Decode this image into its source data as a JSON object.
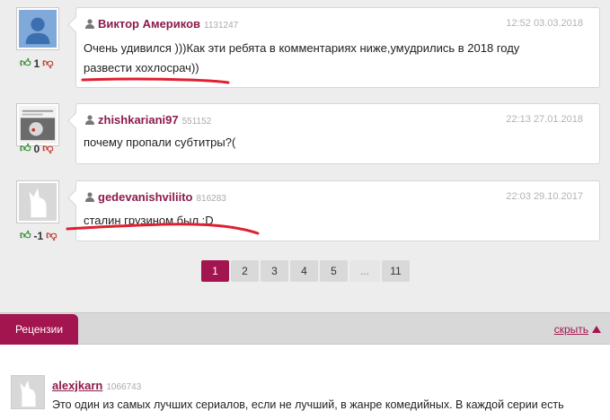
{
  "comments": [
    {
      "author": "Виктор Америков",
      "uid": "1131247",
      "date": "12:52 03.03.2018",
      "text_line1": "Очень удивился )))Как эти ребята в комментариях ниже,умудрились в 2018 году",
      "text_line2": "развести хохлосрач))",
      "votes": "1"
    },
    {
      "author": "zhishkariani97",
      "uid": "551152",
      "date": "22:13 27.01.2018",
      "text_line1": "почему пропали субтитры?(",
      "votes": "0"
    },
    {
      "author": "gedevanishviliito",
      "uid": "816283",
      "date": "22:03 29.10.2017",
      "text_line1": "сталин грузином был :D",
      "votes": "-1"
    }
  ],
  "pagination": {
    "pages": [
      "1",
      "2",
      "3",
      "4",
      "5",
      "...",
      "11"
    ],
    "current": "1"
  },
  "reviews_section": {
    "tab_label": "Рецензии",
    "hide_label": "скрыть"
  },
  "review": {
    "author": "alexjkarn",
    "uid": "1066743",
    "text": "Это один из самых лучших сериалов, если не лучший, в жанре комедийных. В каждой серии есть"
  },
  "colors": {
    "accent": "#a3154f",
    "author": "#8c1b4b",
    "vote_up": "#2e8b2e",
    "vote_down": "#c0392b",
    "underline_marker": "#e02030"
  }
}
